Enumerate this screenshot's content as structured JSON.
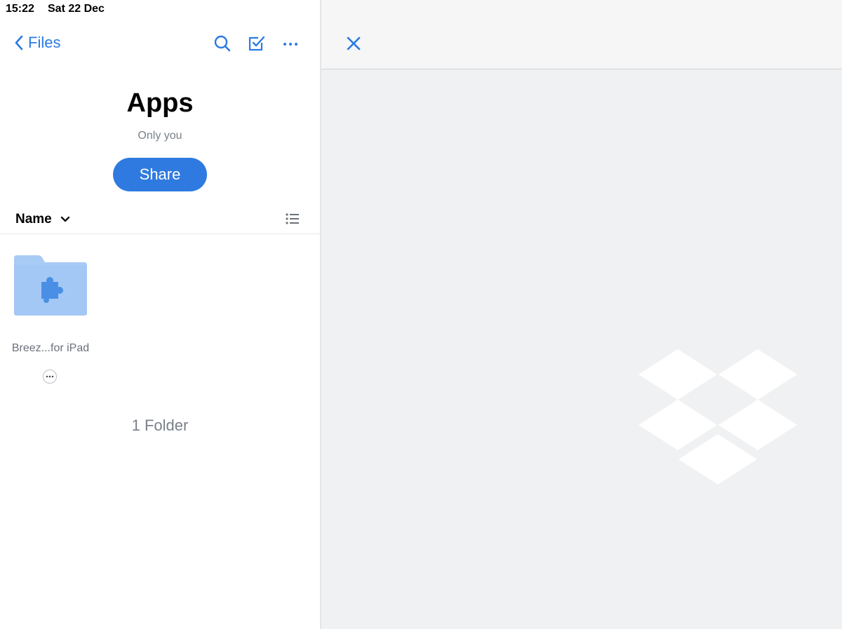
{
  "status_bar": {
    "time": "15:22",
    "date": "Sat 22 Dec"
  },
  "nav": {
    "back_label": "Files"
  },
  "icons": {
    "back": "chevron-left-icon",
    "search": "search-icon",
    "select": "checkbox-icon",
    "more": "ellipsis-icon",
    "sort": "chevron-down-icon",
    "list_view": "list-view-icon",
    "folder": "folder-icon",
    "close": "close-icon",
    "logo": "dropbox-logo"
  },
  "header": {
    "title": "Apps",
    "subtitle": "Only you",
    "share_label": "Share"
  },
  "sort": {
    "label": "Name"
  },
  "items": [
    {
      "name": "Breez...for iPad",
      "type": "folder"
    }
  ],
  "footer": {
    "count": "1 Folder"
  },
  "colors": {
    "accent": "#2f7ae0",
    "folder": "#a8cbf6",
    "folder_glyph": "#4a8fe6",
    "preview_bg": "#f0f1f2"
  }
}
